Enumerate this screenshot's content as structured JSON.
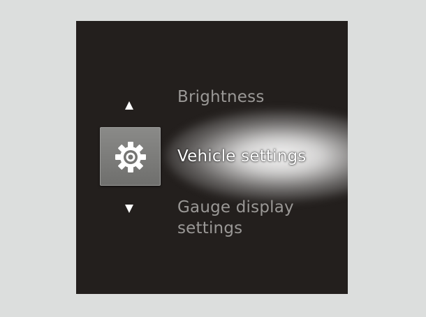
{
  "menu": {
    "previous_item": "Brightness",
    "current_item": "Vehicle settings",
    "next_item": "Gauge display settings",
    "current_icon": "gear-icon",
    "scroll_up_icon": "arrow-up-icon",
    "scroll_down_icon": "arrow-down-icon"
  },
  "colors": {
    "background": "#dcdedd",
    "screen": "#231f1d",
    "selected_text": "#ffffff",
    "inactive_text": "#9a9896",
    "icon_box": "#7a7a78"
  }
}
